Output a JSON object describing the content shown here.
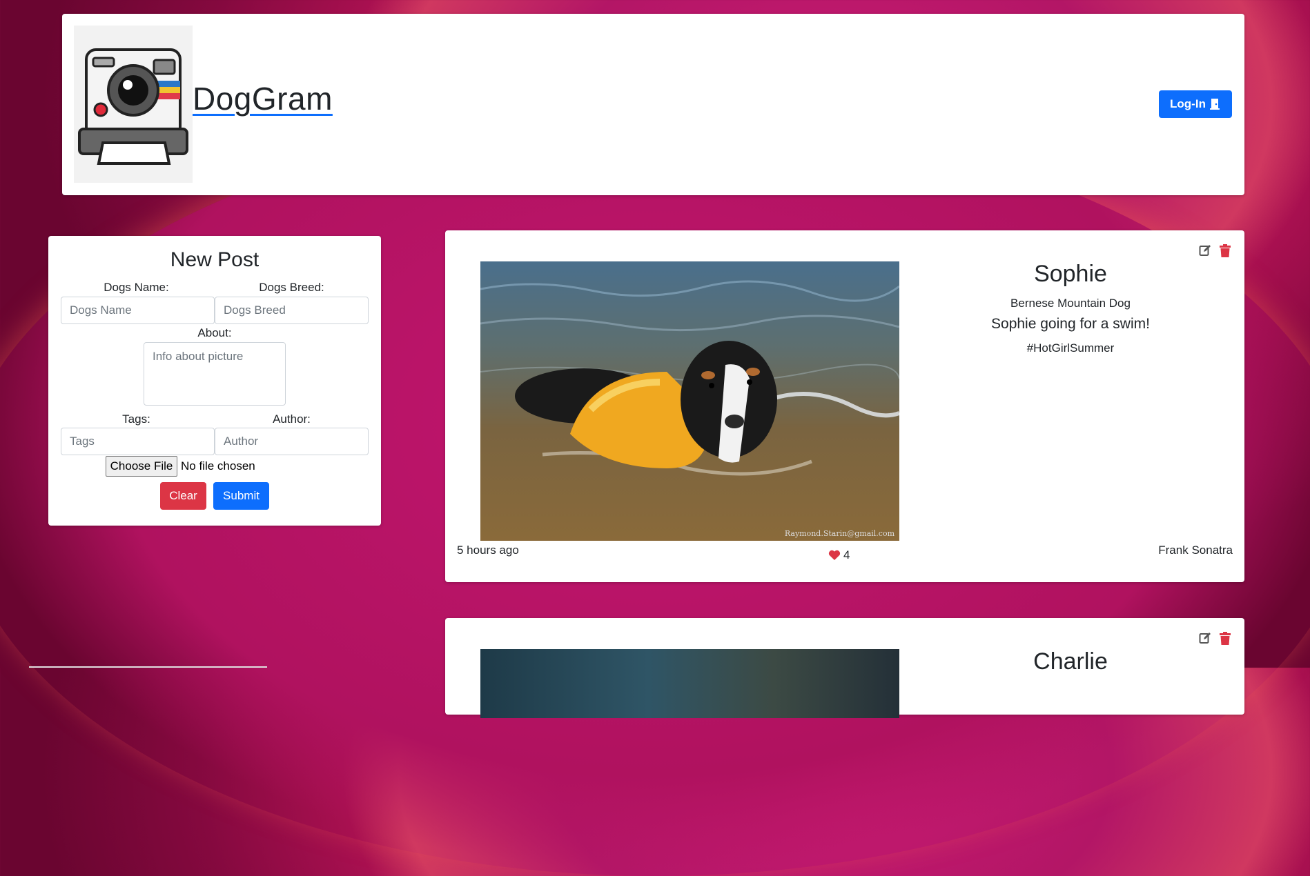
{
  "header": {
    "brand": "DogGram",
    "login_label": "Log-In"
  },
  "form": {
    "title": "New Post",
    "dog_name_label": "Dogs Name:",
    "dog_name_placeholder": "Dogs Name",
    "dog_breed_label": "Dogs Breed:",
    "dog_breed_placeholder": "Dogs Breed",
    "about_label": "About:",
    "about_placeholder": "Info about picture",
    "tags_label": "Tags:",
    "tags_placeholder": "Tags",
    "author_label": "Author:",
    "author_placeholder": "Author",
    "file_button": "Choose File",
    "file_status": "No file chosen",
    "clear_label": "Clear",
    "submit_label": "Submit"
  },
  "posts": [
    {
      "name": "Sophie",
      "breed": "Bernese Mountain Dog",
      "about": "Sophie going for a swim!",
      "tag": "#HotGirlSummer",
      "time": "5 hours ago",
      "likes": "4",
      "author": "Frank Sonatra",
      "watermark": "Raymond.Starin@gmail.com"
    },
    {
      "name": "Charlie"
    }
  ],
  "colors": {
    "primary": "#0d6efd",
    "danger": "#dc3545",
    "heart": "#dc3545"
  }
}
